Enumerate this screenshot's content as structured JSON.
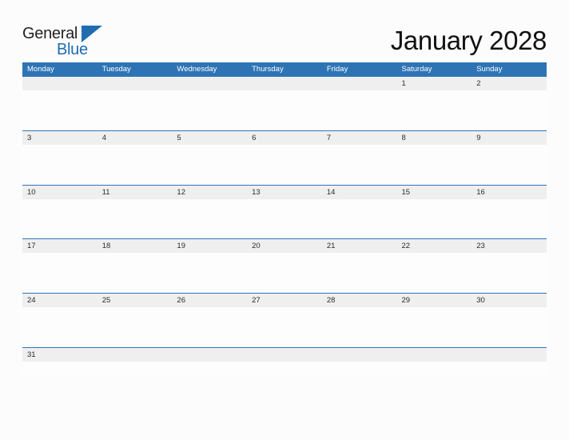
{
  "brand": {
    "name_part1": "General",
    "name_part2": "Blue",
    "triangle_icon": "triangle-icon",
    "color_dark": "#231f20",
    "color_blue": "#1f6cb0"
  },
  "header": {
    "title": "January 2028",
    "month": "January",
    "year": "2028"
  },
  "theme": {
    "header_blue": "#2e74b5",
    "band_gray": "#efefef",
    "page_background": "#fcfcfc",
    "rule_blue": "#2e74b5"
  },
  "calendar": {
    "weekdays": [
      "Monday",
      "Tuesday",
      "Wednesday",
      "Thursday",
      "Friday",
      "Saturday",
      "Sunday"
    ],
    "weeks": [
      {
        "ruled": false,
        "days": [
          "",
          "",
          "",
          "",
          "",
          "1",
          "2"
        ]
      },
      {
        "ruled": true,
        "days": [
          "3",
          "4",
          "5",
          "6",
          "7",
          "8",
          "9"
        ]
      },
      {
        "ruled": true,
        "days": [
          "10",
          "11",
          "12",
          "13",
          "14",
          "15",
          "16"
        ]
      },
      {
        "ruled": true,
        "days": [
          "17",
          "18",
          "19",
          "20",
          "21",
          "22",
          "23"
        ]
      },
      {
        "ruled": true,
        "days": [
          "24",
          "25",
          "26",
          "27",
          "28",
          "29",
          "30"
        ]
      },
      {
        "ruled": true,
        "days": [
          "31",
          "",
          "",
          "",
          "",
          "",
          ""
        ],
        "last": true
      }
    ]
  }
}
